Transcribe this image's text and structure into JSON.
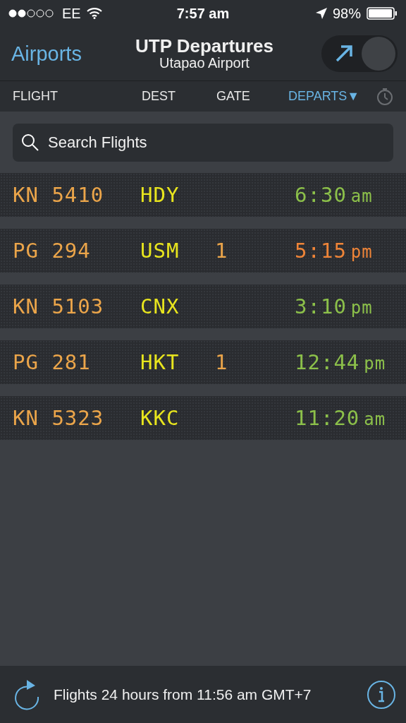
{
  "status_bar": {
    "carrier": "EE",
    "time": "7:57 am",
    "battery": "98%"
  },
  "nav": {
    "back": "Airports",
    "title": "UTP Departures",
    "subtitle": "Utapao Airport"
  },
  "columns": [
    {
      "label": "FLIGHT",
      "selected": false
    },
    {
      "label": "DEST",
      "selected": false
    },
    {
      "label": "GATE",
      "selected": false
    },
    {
      "label": "DEPARTS▼",
      "selected": true
    }
  ],
  "direction_toggle": {
    "on": true
  },
  "search": {
    "placeholder": "Search Flights"
  },
  "flights": [
    {
      "flight": "KN 5410",
      "dest": "HDY",
      "departs": "6:30",
      "meridiem": "am",
      "color": "#8cc04a"
    },
    {
      "flight": "PG 294",
      "dest": "USM",
      "gate": "1",
      "departs": "5:15",
      "meridiem": "pm",
      "color": "#ee8438"
    },
    {
      "flight": "KN 5103",
      "dest": "CNX",
      "departs": "3:10",
      "meridiem": "pm",
      "color": "#8cc04a"
    },
    {
      "flight": "PG 281",
      "dest": "HKT",
      "gate": "1",
      "departs": "12:44",
      "meridiem": "pm",
      "color": "#8cc04a"
    },
    {
      "flight": "KN 5323",
      "dest": "KKC",
      "departs": "11:20",
      "meridiem": "am",
      "color": "#8cc04a"
    }
  ],
  "footer": {
    "text": "Flights 24 hours from 11:56 am GMT+7"
  }
}
